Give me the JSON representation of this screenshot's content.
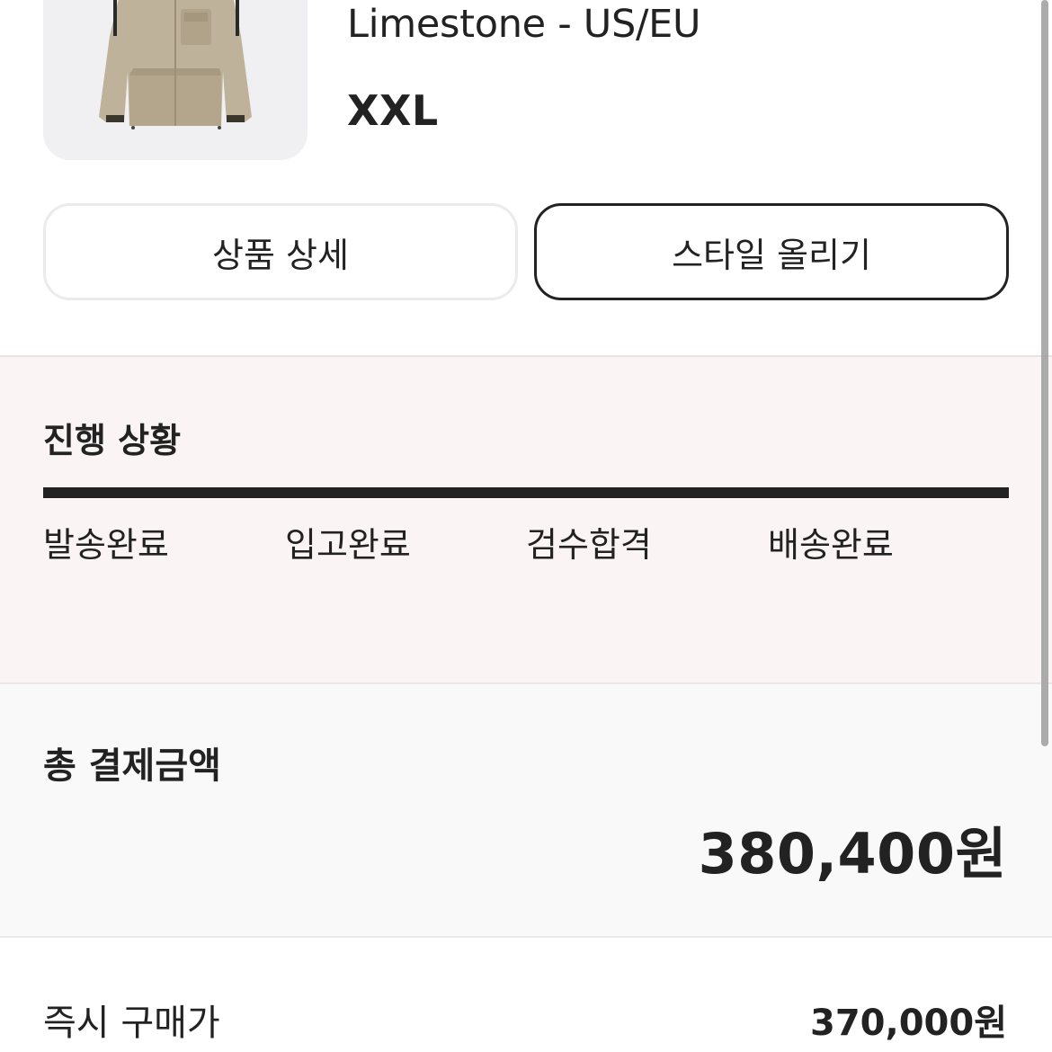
{
  "product": {
    "name_line": "Limestone - US/EU",
    "size": "XXL",
    "image_icon": "jacket-image"
  },
  "actions": {
    "detail_label": "상품 상세",
    "style_label": "스타일 올리기"
  },
  "progress": {
    "title": "진행 상황",
    "steps": [
      "발송완료",
      "입고완료",
      "검수합격",
      "배송완료"
    ],
    "completion": 1.0
  },
  "payment": {
    "total_label": "총 결제금액",
    "total_amount": "380,400원",
    "buy_now_label": "즉시 구매가",
    "buy_now_price": "370,000원"
  },
  "colors": {
    "text": "#222222",
    "progress_bg": "#fbf4f4",
    "total_bg": "#f9f9f9",
    "thumb_bg": "#f0f0f2"
  }
}
